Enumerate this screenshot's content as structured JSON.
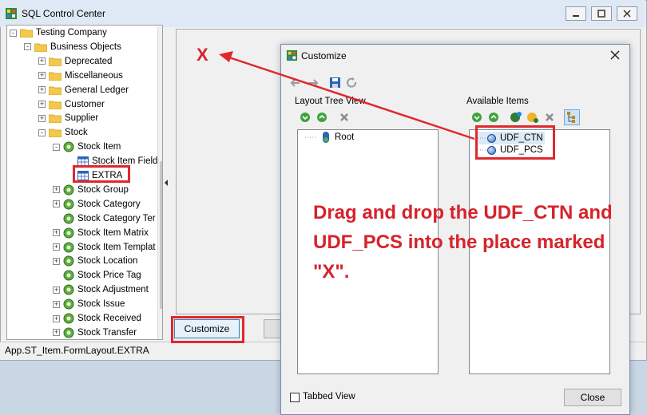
{
  "app": {
    "title": "SQL Control Center",
    "status_path": "App.ST_Item.FormLayout.EXTRA",
    "customize_label": "Customize"
  },
  "tree": {
    "items": [
      {
        "label": "Testing Company",
        "level": 0,
        "expander": "-",
        "icon": "folder"
      },
      {
        "label": "Business Objects",
        "level": 1,
        "expander": "-",
        "icon": "folder"
      },
      {
        "label": "Deprecated",
        "level": 2,
        "expander": "+",
        "icon": "folder"
      },
      {
        "label": "Miscellaneous",
        "level": 2,
        "expander": "+",
        "icon": "folder"
      },
      {
        "label": "General Ledger",
        "level": 2,
        "expander": "+",
        "icon": "folder"
      },
      {
        "label": "Customer",
        "level": 2,
        "expander": "+",
        "icon": "folder"
      },
      {
        "label": "Supplier",
        "level": 2,
        "expander": "+",
        "icon": "folder"
      },
      {
        "label": "Stock",
        "level": 2,
        "expander": "-",
        "icon": "folder"
      },
      {
        "label": "Stock Item",
        "level": 3,
        "expander": "-",
        "icon": "gear"
      },
      {
        "label": "Stock Item Field",
        "level": 4,
        "expander": "",
        "icon": "grid"
      },
      {
        "label": "EXTRA",
        "level": 4,
        "expander": "",
        "icon": "grid"
      },
      {
        "label": "Stock Group",
        "level": 3,
        "expander": "+",
        "icon": "gear"
      },
      {
        "label": "Stock Category",
        "level": 3,
        "expander": "+",
        "icon": "gear"
      },
      {
        "label": "Stock Category Ter",
        "level": 3,
        "expander": "",
        "icon": "gear"
      },
      {
        "label": "Stock Item Matrix",
        "level": 3,
        "expander": "+",
        "icon": "gear"
      },
      {
        "label": "Stock Item Templat",
        "level": 3,
        "expander": "+",
        "icon": "gear"
      },
      {
        "label": "Stock Location",
        "level": 3,
        "expander": "+",
        "icon": "gear"
      },
      {
        "label": "Stock Price Tag",
        "level": 3,
        "expander": "",
        "icon": "gear"
      },
      {
        "label": "Stock Adjustment",
        "level": 3,
        "expander": "+",
        "icon": "gear"
      },
      {
        "label": "Stock Issue",
        "level": 3,
        "expander": "+",
        "icon": "gear"
      },
      {
        "label": "Stock Received",
        "level": 3,
        "expander": "+",
        "icon": "gear"
      },
      {
        "label": "Stock Transfer",
        "level": 3,
        "expander": "+",
        "icon": "gear"
      }
    ]
  },
  "dialog": {
    "title": "Customize",
    "layout_tree_label": "Layout Tree View",
    "available_label": "Available Items",
    "root_label": "Root",
    "available_items": [
      "UDF_CTN",
      "UDF_PCS"
    ],
    "tabbed_view_label": "Tabbed View",
    "close_label": "Close"
  },
  "annotation": {
    "instruction": "Drag and drop the UDF_CTN and UDF_PCS into the place marked \"X\".",
    "mark": "X",
    "color": "#d6232b"
  }
}
